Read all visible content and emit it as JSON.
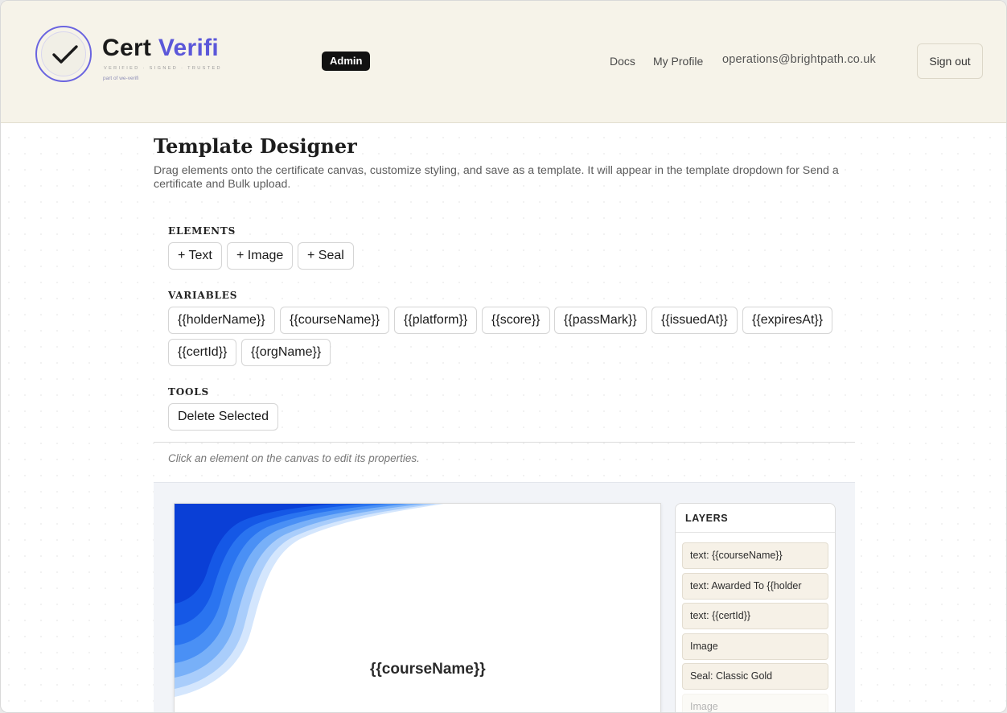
{
  "header": {
    "brand_primary": "Cert ",
    "brand_accent": "Verifi",
    "tagline": "VERIFIED · SIGNED · TRUSTED",
    "part_of": "part of we-verifi",
    "role_badge": "Admin",
    "nav": {
      "docs": "Docs",
      "profile": "My Profile",
      "email": "operations@brightpath.co.uk"
    },
    "sign_out": "Sign out"
  },
  "page": {
    "title": "Template Designer",
    "description": "Drag elements onto the certificate canvas, customize styling, and save as a template. It will appear in the template dropdown for Send a certificate and Bulk upload."
  },
  "elements": {
    "label": "ELEMENTS",
    "buttons": [
      "+ Text",
      "+ Image",
      "+ Seal"
    ]
  },
  "variables": {
    "label": "VARIABLES",
    "items": [
      "{{holderName}}",
      "{{courseName}}",
      "{{platform}}",
      "{{score}}",
      "{{passMark}}",
      "{{issuedAt}}",
      "{{expiresAt}}",
      "{{certId}}",
      "{{orgName}}"
    ]
  },
  "tools": {
    "label": "TOOLS",
    "delete": "Delete Selected"
  },
  "hint": "Click an element on the canvas to edit its properties.",
  "canvas": {
    "text_element": "{{courseName}}",
    "wave_colors": [
      "#0a3fd6",
      "#1558e6",
      "#2a74f0",
      "#4a90f5",
      "#78b0f8",
      "#a9cdfb",
      "#d4e6fd"
    ]
  },
  "layers": {
    "title": "LAYERS",
    "items": [
      "text: {{courseName}}",
      "text: Awarded To {{holder",
      "text: {{certId}}",
      "Image",
      "Seal: Classic Gold",
      "Image"
    ]
  },
  "colors": {
    "accent": "#5b57d9",
    "header_bg": "#f6f3e9",
    "badge_bg": "#111111"
  }
}
